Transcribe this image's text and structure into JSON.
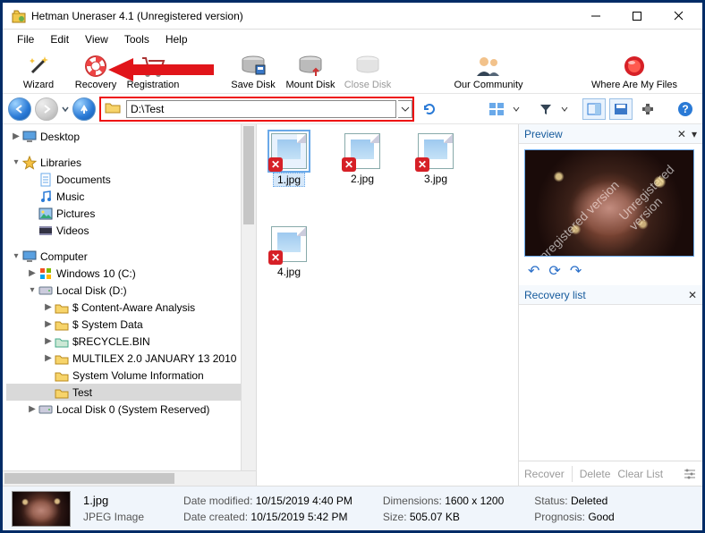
{
  "window": {
    "title": "Hetman Uneraser 4.1 (Unregistered version)"
  },
  "menu": {
    "file": "File",
    "edit": "Edit",
    "view": "View",
    "tools": "Tools",
    "help": "Help"
  },
  "toolbar": {
    "wizard": "Wizard",
    "recovery": "Recovery",
    "registration": "Registration",
    "save_disk": "Save Disk",
    "mount_disk": "Mount Disk",
    "close_disk": "Close Disk",
    "community": "Our Community",
    "where": "Where Are My Files"
  },
  "address": {
    "path": "D:\\Test"
  },
  "tree": {
    "desktop": "Desktop",
    "libraries": "Libraries",
    "documents": "Documents",
    "music": "Music",
    "pictures": "Pictures",
    "videos": "Videos",
    "computer": "Computer",
    "win10": "Windows 10 (C:)",
    "ldd": "Local Disk (D:)",
    "caa": "$ Content-Aware Analysis",
    "sysdata": "$ System Data",
    "recycle": "$RECYCLE.BIN",
    "multilex": "MULTILEX 2.0 JANUARY 13 2010",
    "svi": "System Volume Information",
    "test": "Test",
    "ld0": "Local Disk 0 (System Reserved)"
  },
  "files": {
    "f1": "1.jpg",
    "f2": "2.jpg",
    "f3": "3.jpg",
    "f4": "4.jpg"
  },
  "preview": {
    "title": "Preview",
    "watermark": "Unregistered version"
  },
  "recovery_list": {
    "title": "Recovery list",
    "recover": "Recover",
    "delete": "Delete",
    "clear": "Clear List"
  },
  "status": {
    "name": "1.jpg",
    "type": "JPEG Image",
    "mod_l": "Date modified:",
    "mod_v": "10/15/2019 4:40 PM",
    "cre_l": "Date created:",
    "cre_v": "10/15/2019 5:42 PM",
    "dim_l": "Dimensions:",
    "dim_v": "1600 x 1200",
    "size_l": "Size:",
    "size_v": "505.07 KB",
    "stat_l": "Status:",
    "stat_v": "Deleted",
    "prog_l": "Prognosis:",
    "prog_v": "Good"
  }
}
